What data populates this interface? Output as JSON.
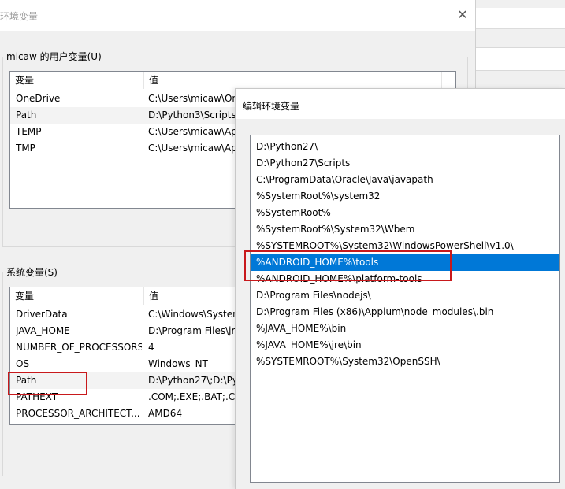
{
  "env_dialog": {
    "title": "环境变量",
    "close_glyph": "✕",
    "user_vars": {
      "group_label": "micaw 的用户变量(U)",
      "columns": [
        "变量",
        "值"
      ],
      "rows": [
        {
          "name": "OneDrive",
          "value": "C:\\Users\\micaw\\On"
        },
        {
          "name": "Path",
          "value": "D:\\Python3\\Scripts\\"
        },
        {
          "name": "TEMP",
          "value": "C:\\Users\\micaw\\Ap"
        },
        {
          "name": "TMP",
          "value": "C:\\Users\\micaw\\Ap"
        }
      ]
    },
    "system_vars": {
      "group_label": "系统变量(S)",
      "columns": [
        "变量",
        "值"
      ],
      "rows": [
        {
          "name": "DriverData",
          "value": "C:\\Windows\\System"
        },
        {
          "name": "JAVA_HOME",
          "value": "D:\\Program Files\\jr"
        },
        {
          "name": "NUMBER_OF_PROCESSORS",
          "value": "4"
        },
        {
          "name": "OS",
          "value": "Windows_NT"
        },
        {
          "name": "Path",
          "value": "D:\\Python27\\;D:\\Pyt"
        },
        {
          "name": "PATHEXT",
          "value": ".COM;.EXE;.BAT;.CM"
        },
        {
          "name": "PROCESSOR_ARCHITECT...",
          "value": "AMD64"
        }
      ]
    }
  },
  "edit_dialog": {
    "title": "编辑环境变量",
    "selected_index": 7,
    "entries": [
      "D:\\Python27\\",
      "D:\\Python27\\Scripts",
      "C:\\ProgramData\\Oracle\\Java\\javapath",
      "%SystemRoot%\\system32",
      "%SystemRoot%",
      "%SystemRoot%\\System32\\Wbem",
      "%SYSTEMROOT%\\System32\\WindowsPowerShell\\v1.0\\",
      "%ANDROID_HOME%\\tools",
      "%ANDROID_HOME%\\platform-tools",
      "D:\\Program Files\\nodejs\\",
      "D:\\Program Files (x86)\\Appium\\node_modules\\.bin",
      "%JAVA_HOME%\\bin",
      "%JAVA_HOME%\\jre\\bin",
      "%SYSTEMROOT%\\System32\\OpenSSH\\"
    ]
  },
  "colors": {
    "selection": "#0078d7",
    "highlight_box": "#c8191c",
    "dialog_bg": "#f0f0f0"
  }
}
